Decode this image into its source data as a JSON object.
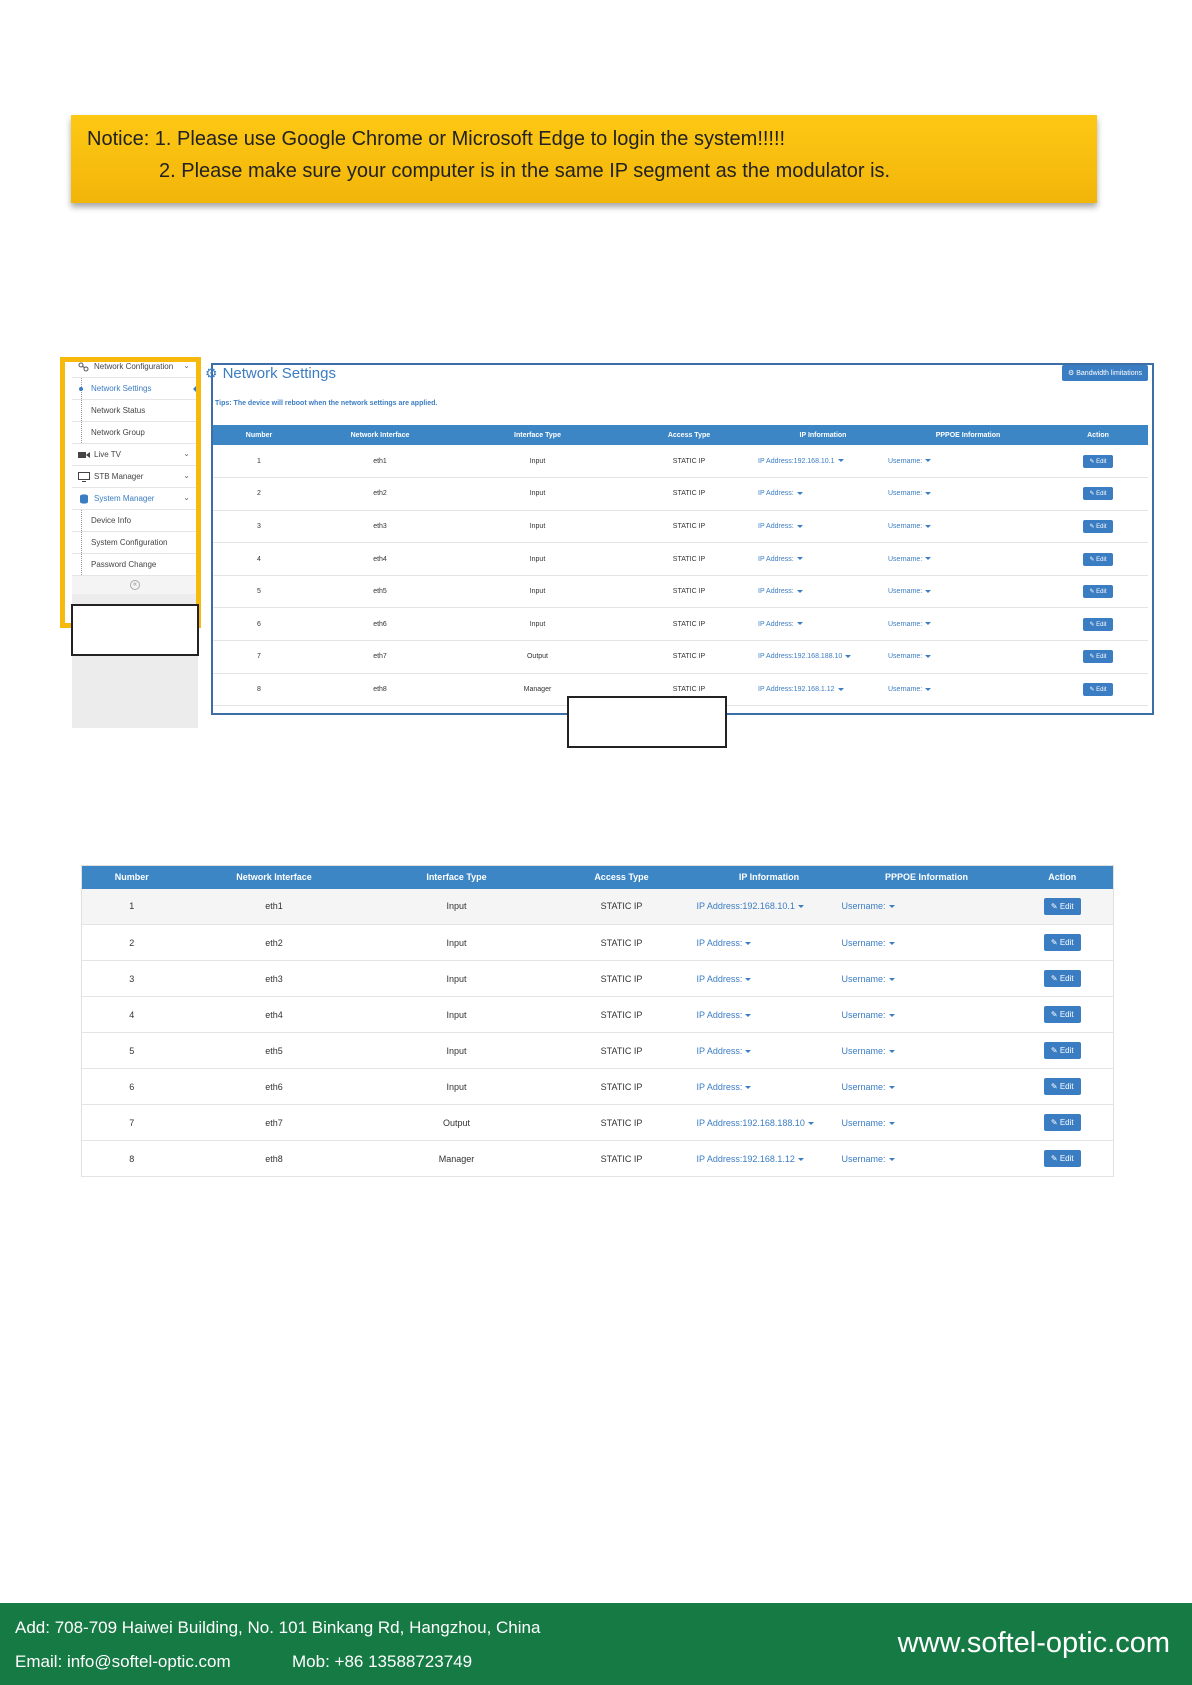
{
  "notice": {
    "line1": "Notice: 1. Please use Google Chrome or Microsoft Edge to login the system!!!!!",
    "line2": "2. Please make sure your computer is in the same IP segment as the modulator is."
  },
  "sidebar": {
    "groups": [
      {
        "label": "Network Configuration",
        "icon": "network-icon"
      },
      {
        "label": "Live TV",
        "icon": "video-icon"
      },
      {
        "label": "STB Manager",
        "icon": "monitor-icon"
      },
      {
        "label": "System Manager",
        "icon": "database-icon"
      }
    ],
    "network_items": [
      "Network Settings",
      "Network Status",
      "Network Group"
    ],
    "system_items": [
      "Device Info",
      "System Configuration",
      "Password Change"
    ],
    "collapse_symbol": "«"
  },
  "panel": {
    "title": "Network Settings",
    "bandwidth_button": "Bandwidth limitations",
    "tips": "Tips: The device will reboot when the network settings are applied."
  },
  "table": {
    "headers": [
      "Number",
      "Network Interface",
      "Interface Type",
      "Access Type",
      "IP Information",
      "PPPOE Information",
      "Action"
    ],
    "edit_label": "Edit",
    "rows": [
      {
        "number": "1",
        "iface": "eth1",
        "type": "Input",
        "access": "STATIC IP",
        "ip": "IP Address:192.168.10.1",
        "pppoe": "Username:"
      },
      {
        "number": "2",
        "iface": "eth2",
        "type": "Input",
        "access": "STATIC IP",
        "ip": "IP Address:",
        "pppoe": "Username:"
      },
      {
        "number": "3",
        "iface": "eth3",
        "type": "Input",
        "access": "STATIC IP",
        "ip": "IP Address:",
        "pppoe": "Username:"
      },
      {
        "number": "4",
        "iface": "eth4",
        "type": "Input",
        "access": "STATIC IP",
        "ip": "IP Address:",
        "pppoe": "Username:"
      },
      {
        "number": "5",
        "iface": "eth5",
        "type": "Input",
        "access": "STATIC IP",
        "ip": "IP Address:",
        "pppoe": "Username:"
      },
      {
        "number": "6",
        "iface": "eth6",
        "type": "Input",
        "access": "STATIC IP",
        "ip": "IP Address:",
        "pppoe": "Username:"
      },
      {
        "number": "7",
        "iface": "eth7",
        "type": "Output",
        "access": "STATIC IP",
        "ip": "IP Address:192.168.188.10",
        "pppoe": "Username:"
      },
      {
        "number": "8",
        "iface": "eth8",
        "type": "Manager",
        "access": "STATIC IP",
        "ip": "IP Address:192.168.1.12",
        "pppoe": "Username:"
      }
    ]
  },
  "footer": {
    "address": "Add: 708-709 Haiwei Building, No. 101 Binkang Rd, Hangzhou, China",
    "email": "Email: info@softel-optic.com",
    "mobile": "Mob: +86 13588723749",
    "website": "www.softel-optic.com"
  },
  "colors": {
    "accent": "#3b7dc3",
    "header": "#3c86c6",
    "notice": "#fdc814",
    "frame": "#f6b90c",
    "footer": "#167a45"
  }
}
